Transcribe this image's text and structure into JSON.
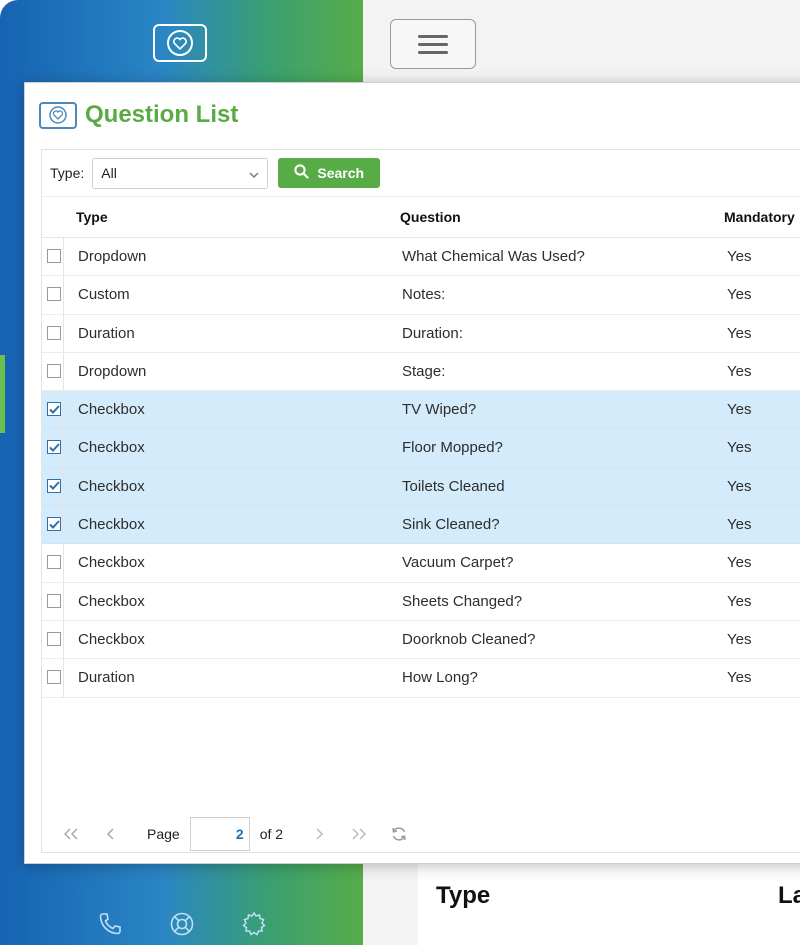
{
  "background": {
    "table_header": {
      "type_label": "Type",
      "second_label": "La"
    }
  },
  "dialog": {
    "title": "Question List",
    "filter": {
      "label": "Type:",
      "selected": "All",
      "search_label": "Search"
    },
    "columns": {
      "type": "Type",
      "question": "Question",
      "mandatory": "Mandatory"
    },
    "rows": [
      {
        "type": "Dropdown",
        "question": "What Chemical Was Used?",
        "mandatory": "Yes",
        "checked": false
      },
      {
        "type": "Custom",
        "question": "Notes:",
        "mandatory": "Yes",
        "checked": false
      },
      {
        "type": "Duration",
        "question": "Duration:",
        "mandatory": "Yes",
        "checked": false
      },
      {
        "type": "Dropdown",
        "question": "Stage:",
        "mandatory": "Yes",
        "checked": false
      },
      {
        "type": "Checkbox",
        "question": "TV Wiped?",
        "mandatory": "Yes",
        "checked": true
      },
      {
        "type": "Checkbox",
        "question": "Floor Mopped?",
        "mandatory": "Yes",
        "checked": true
      },
      {
        "type": "Checkbox",
        "question": "Toilets Cleaned",
        "mandatory": "Yes",
        "checked": true
      },
      {
        "type": "Checkbox",
        "question": "Sink Cleaned?",
        "mandatory": "Yes",
        "checked": true
      },
      {
        "type": "Checkbox",
        "question": "Vacuum Carpet?",
        "mandatory": "Yes",
        "checked": false
      },
      {
        "type": "Checkbox",
        "question": "Sheets Changed?",
        "mandatory": "Yes",
        "checked": false
      },
      {
        "type": "Checkbox",
        "question": "Doorknob Cleaned?",
        "mandatory": "Yes",
        "checked": false
      },
      {
        "type": "Duration",
        "question": "How Long?",
        "mandatory": "Yes",
        "checked": false
      }
    ],
    "pager": {
      "page_label": "Page",
      "current_page": "2",
      "of_label": "of 2"
    }
  },
  "colors": {
    "accent_green": "#58ac45",
    "selected_row": "#d4ebfc",
    "sidebar_blue": "#1663b2"
  },
  "icons": [
    "heart-logo-icon",
    "menu-icon",
    "search-icon",
    "chevron-down-icon",
    "first-page-icon",
    "prev-page-icon",
    "next-page-icon",
    "last-page-icon",
    "refresh-icon",
    "phone-icon",
    "support-icon",
    "settings-icon"
  ]
}
